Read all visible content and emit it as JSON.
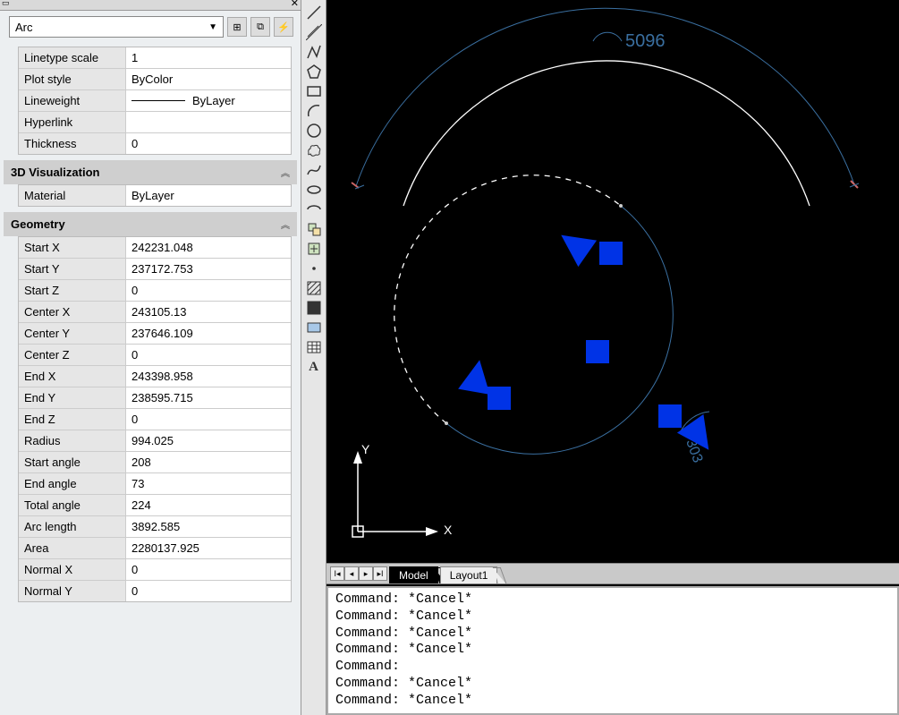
{
  "selector": {
    "value": "Arc"
  },
  "icons": {
    "pickadd": "⊞",
    "select": "⧉",
    "quick": "⚡"
  },
  "general": [
    {
      "label": "Linetype scale",
      "value": "1"
    },
    {
      "label": "Plot style",
      "value": "ByColor"
    },
    {
      "label": "Lineweight",
      "value": "ByLayer",
      "lineweight": true
    },
    {
      "label": "Hyperlink",
      "value": ""
    },
    {
      "label": "Thickness",
      "value": "0"
    }
  ],
  "viz_section": "3D Visualization",
  "viz": [
    {
      "label": "Material",
      "value": "ByLayer"
    }
  ],
  "geom_section": "Geometry",
  "geom": [
    {
      "label": "Start X",
      "value": "242231.048"
    },
    {
      "label": "Start Y",
      "value": "237172.753"
    },
    {
      "label": "Start Z",
      "value": "0"
    },
    {
      "label": "Center X",
      "value": "243105.13"
    },
    {
      "label": "Center Y",
      "value": "237646.109"
    },
    {
      "label": "Center Z",
      "value": "0"
    },
    {
      "label": "End X",
      "value": "243398.958"
    },
    {
      "label": "End Y",
      "value": "238595.715"
    },
    {
      "label": "End Z",
      "value": "0"
    },
    {
      "label": "Radius",
      "value": "994.025"
    },
    {
      "label": "Start angle",
      "value": "208"
    },
    {
      "label": "End angle",
      "value": "73"
    },
    {
      "label": "Total angle",
      "value": "224"
    },
    {
      "label": "Arc length",
      "value": "3892.585"
    },
    {
      "label": "Area",
      "value": "2280137.925"
    },
    {
      "label": "Normal X",
      "value": "0"
    },
    {
      "label": "Normal Y",
      "value": "0"
    }
  ],
  "canvas": {
    "dim_text": "5096",
    "angle_text": "303",
    "ucs_x": "X",
    "ucs_y": "Y"
  },
  "tabs": {
    "model": "Model",
    "layout1": "Layout1"
  },
  "cmd_lines": [
    "Command: *Cancel*",
    "Command: *Cancel*",
    "Command: *Cancel*",
    "Command: *Cancel*",
    "Command:",
    "Command: *Cancel*",
    "Command: *Cancel*"
  ]
}
